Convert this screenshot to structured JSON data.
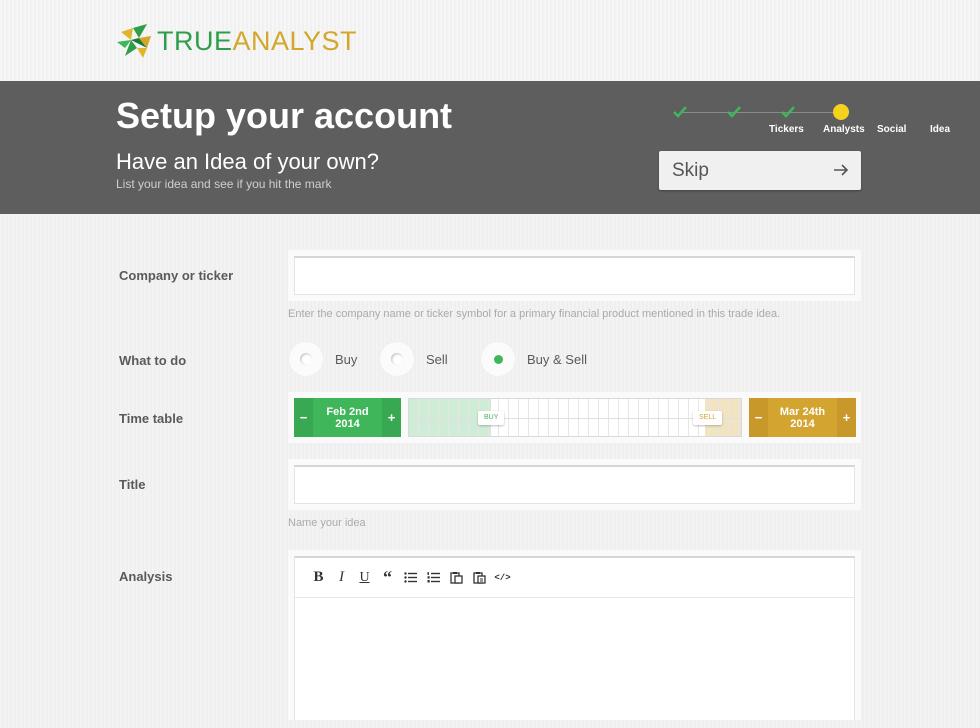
{
  "brand": {
    "true": "TRUE",
    "analyst": "ANALYST"
  },
  "header": {
    "title": "Setup your account",
    "subtitle": "Have an Idea of your own?",
    "description": "List your idea and see if you hit the mark",
    "skip_label": "Skip"
  },
  "steps": [
    {
      "label": "Tickers",
      "state": "done"
    },
    {
      "label": "Analysts",
      "state": "done"
    },
    {
      "label": "Social",
      "state": "done"
    },
    {
      "label": "Idea",
      "state": "current"
    }
  ],
  "form": {
    "company": {
      "label": "Company or ticker",
      "value": "",
      "hint": "Enter the company name or ticker symbol for a primary financial product mentioned in this trade idea."
    },
    "what_to_do": {
      "label": "What to do",
      "options": [
        {
          "label": "Buy",
          "selected": false
        },
        {
          "label": "Sell",
          "selected": false
        },
        {
          "label": "Buy & Sell",
          "selected": true
        }
      ]
    },
    "timetable": {
      "label": "Time table",
      "start": {
        "line1": "Feb 2nd",
        "line2": "2014"
      },
      "end": {
        "line1": "Mar 24th",
        "line2": "2014"
      },
      "minus": "−",
      "plus": "+",
      "buy_handle": "BUY",
      "sell_handle": "SELL"
    },
    "title": {
      "label": "Title",
      "value": "",
      "hint": "Name your idea"
    },
    "analysis": {
      "label": "Analysis",
      "value": ""
    }
  },
  "colors": {
    "green": "#3fb65a",
    "gold": "#d4a430",
    "header_bg": "#5e5e5e",
    "step_current": "#f5d01c"
  },
  "toolbar_icons": [
    "bold-icon",
    "italic-icon",
    "underline-icon",
    "quote-icon",
    "bullet-list-icon",
    "numbered-list-icon",
    "paste-icon",
    "paste-text-icon",
    "code-icon"
  ]
}
